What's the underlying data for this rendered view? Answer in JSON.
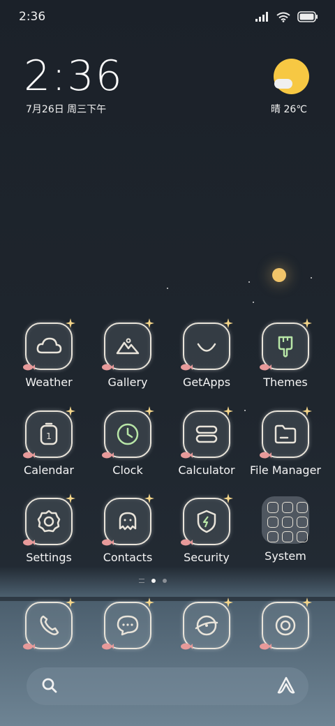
{
  "status_bar": {
    "time": "2:36"
  },
  "clock_widget": {
    "time": "2:36",
    "date": "7月26日 周三下午"
  },
  "weather_widget": {
    "condition_temp": "晴 26℃"
  },
  "apps": [
    {
      "label": "Weather",
      "icon": "cloud-icon"
    },
    {
      "label": "Gallery",
      "icon": "mountain-icon"
    },
    {
      "label": "GetApps",
      "icon": "smile-icon"
    },
    {
      "label": "Themes",
      "icon": "brush-icon"
    },
    {
      "label": "Calendar",
      "icon": "calendar-icon",
      "day": "1"
    },
    {
      "label": "Clock",
      "icon": "clock-icon"
    },
    {
      "label": "Calculator",
      "icon": "calculator-icon"
    },
    {
      "label": "File Manager",
      "icon": "folder-icon"
    },
    {
      "label": "Settings",
      "icon": "gear-icon"
    },
    {
      "label": "Contacts",
      "icon": "contacts-icon"
    },
    {
      "label": "Security",
      "icon": "shield-icon"
    },
    {
      "label": "System",
      "icon": "folder-grid-icon"
    }
  ],
  "dock": [
    {
      "icon": "phone-icon"
    },
    {
      "icon": "messages-icon"
    },
    {
      "icon": "browser-icon"
    },
    {
      "icon": "camera-icon"
    }
  ],
  "colors": {
    "sun": "#f7c843",
    "icon_outline": "#e9e4da",
    "background": "#1f262e"
  }
}
